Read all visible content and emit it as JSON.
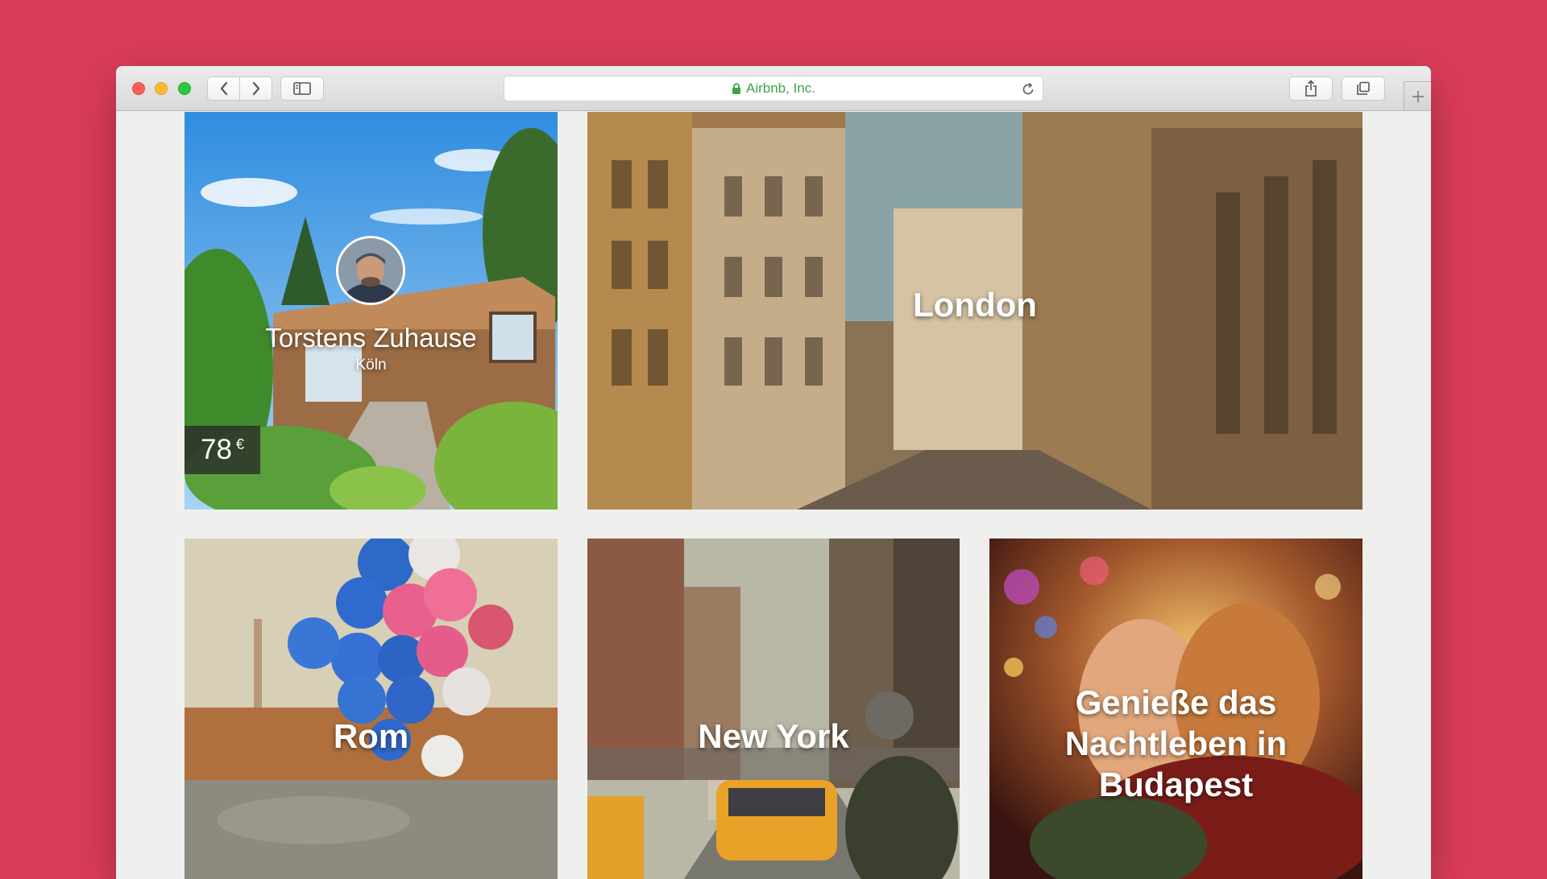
{
  "browser": {
    "address_text": "Airbnb, Inc."
  },
  "tiles": {
    "home": {
      "title": "Torstens Zuhause",
      "city": "Köln",
      "price_value": "78",
      "price_currency": "€"
    },
    "london": {
      "label": "London"
    },
    "rom": {
      "label": "Rom"
    },
    "new_york": {
      "label": "New York"
    },
    "budapest": {
      "label": "Genieße das Nachtleben in Budapest"
    }
  },
  "colors": {
    "page_background": "#d93c58",
    "content_background": "#eff0ee",
    "secure_text": "#3fa446"
  },
  "icons": [
    "back-arrow-icon",
    "forward-arrow-icon",
    "sidebar-icon",
    "lock-icon",
    "reload-icon",
    "share-icon",
    "tabs-icon",
    "plus-icon"
  ]
}
